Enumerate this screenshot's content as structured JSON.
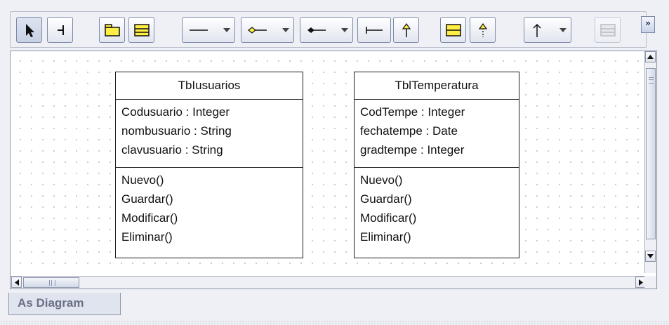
{
  "toolbar": {
    "tools": [
      {
        "name": "pointer-tool",
        "icon": "arrow-pointer-icon"
      },
      {
        "name": "text-cursor-tool",
        "icon": "text-cursor-icon"
      },
      {
        "name": "package-tool",
        "icon": "folder-icon"
      },
      {
        "name": "class-tool",
        "icon": "class-box-icon"
      },
      {
        "name": "line-style-dropdown",
        "icon": "plain-line-icon"
      },
      {
        "name": "aggregation-dropdown",
        "icon": "diamond-line-icon"
      },
      {
        "name": "composition-dropdown",
        "icon": "filled-diamond-line-icon"
      },
      {
        "name": "dependency-tool",
        "icon": "bar-line-icon"
      },
      {
        "name": "generalization-tool",
        "icon": "arrow-up-icon"
      },
      {
        "name": "interface-tool",
        "icon": "interface-box-icon"
      },
      {
        "name": "realization-tool",
        "icon": "hollow-arrow-up-icon"
      },
      {
        "name": "association-dropdown",
        "icon": "up-arrow-icon"
      },
      {
        "name": "note-tool",
        "icon": "disabled-box-icon"
      }
    ],
    "overflow_label": "»"
  },
  "diagram": {
    "classes": [
      {
        "name": "TbIusuarios",
        "attributes": [
          "Codusuario : Integer",
          "nombusuario : String",
          "clavusuario : String"
        ],
        "operations": [
          "Nuevo()",
          "Guardar()",
          "Modificar()",
          "Eliminar()"
        ]
      },
      {
        "name": "TblTemperatura",
        "attributes": [
          "CodTempe : Integer",
          "fechatempe : Date",
          "gradtempe : Integer"
        ],
        "operations": [
          "Nuevo()",
          "Guardar()",
          "Modificar()",
          "Eliminar()"
        ]
      }
    ]
  },
  "tabs": [
    {
      "label": "As Diagram",
      "selected": true
    }
  ],
  "colors": {
    "accent_yellow": "#ffee44",
    "border": "#7e8aa8",
    "chrome": "#eef0f6"
  }
}
